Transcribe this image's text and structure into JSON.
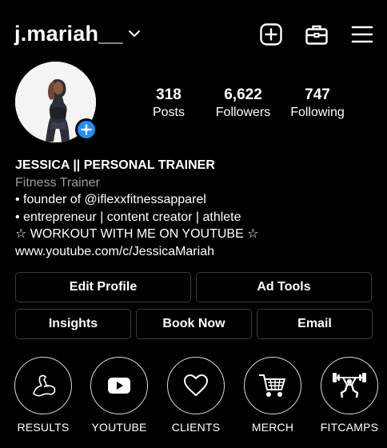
{
  "header": {
    "username": "j.mariah__",
    "icons": [
      "chevron-down-icon",
      "new-post-icon",
      "briefcase-icon",
      "menu-icon"
    ]
  },
  "profile": {
    "avatar": "avatar",
    "stats": [
      {
        "value": "318",
        "label": "Posts"
      },
      {
        "value": "6,622",
        "label": "Followers"
      },
      {
        "value": "747",
        "label": "Following"
      }
    ]
  },
  "bio": {
    "name": "JESSICA || PERSONAL TRAINER",
    "category": "Fitness Trainer",
    "lines": [
      "• founder of @iflexxfitnessapparel",
      "• entrepreneur | content creator | athlete",
      "☆ WORKOUT WITH ME ON YOUTUBE ☆",
      "www.youtube.com/c/JessicaMariah"
    ]
  },
  "buttons": {
    "edit_profile": "Edit Profile",
    "ad_tools": "Ad Tools",
    "insights": "Insights",
    "book_now": "Book Now",
    "email": "Email"
  },
  "highlights": [
    {
      "label": "RESULTS",
      "icon": "flexed-arm-icon"
    },
    {
      "label": "YOUTUBE",
      "icon": "youtube-icon"
    },
    {
      "label": "CLIENTS",
      "icon": "heart-icon"
    },
    {
      "label": "MERCH",
      "icon": "shopping-cart-icon"
    },
    {
      "label": "FITCAMPS",
      "icon": "weightlifter-icon"
    }
  ],
  "colors": {
    "background": "#000000",
    "accent": "#1f8ff5",
    "secondary_text": "#9b9b9b",
    "border": "#3a3a3a"
  }
}
